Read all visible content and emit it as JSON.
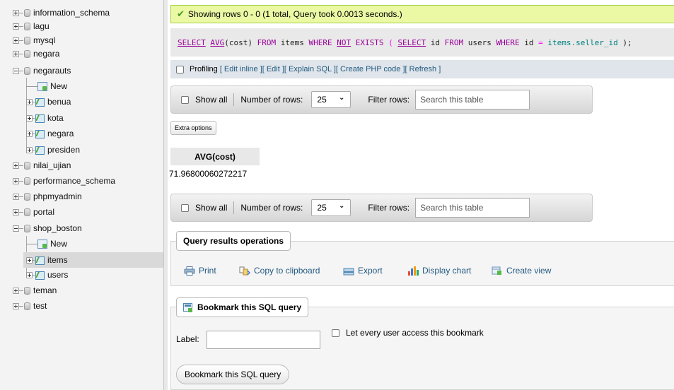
{
  "sidebar": {
    "items": [
      {
        "label": "information_schema",
        "kind": "db",
        "expanded": false
      },
      {
        "label": "lagu",
        "kind": "db",
        "expanded": false
      },
      {
        "label": "mysql",
        "kind": "db",
        "expanded": false
      },
      {
        "label": "negara",
        "kind": "db",
        "expanded": false
      },
      {
        "label": "negarauts",
        "kind": "db",
        "expanded": true
      },
      {
        "label": "New",
        "kind": "new"
      },
      {
        "label": "benua",
        "kind": "table"
      },
      {
        "label": "kota",
        "kind": "table"
      },
      {
        "label": "negara",
        "kind": "table"
      },
      {
        "label": "presiden",
        "kind": "table"
      },
      {
        "label": "nilai_ujian",
        "kind": "db",
        "expanded": false
      },
      {
        "label": "performance_schema",
        "kind": "db",
        "expanded": false
      },
      {
        "label": "phpmyadmin",
        "kind": "db",
        "expanded": false
      },
      {
        "label": "portal",
        "kind": "db",
        "expanded": false
      },
      {
        "label": "shop_boston",
        "kind": "db",
        "expanded": true
      },
      {
        "label": "New",
        "kind": "new"
      },
      {
        "label": "items",
        "kind": "table",
        "selected": true
      },
      {
        "label": "users",
        "kind": "table"
      },
      {
        "label": "teman",
        "kind": "db",
        "expanded": false
      },
      {
        "label": "test",
        "kind": "db",
        "expanded": false
      }
    ]
  },
  "status": {
    "message": "Showing rows 0 - 0 (1 total, Query took 0.0013 seconds.)",
    "color": "#ebf8a4"
  },
  "sql": {
    "select": "SELECT",
    "avg": "AVG",
    "arg": "(cost)",
    "from": "FROM",
    "table": "items",
    "where": "WHERE",
    "not": "NOT",
    "exists": "EXISTS",
    "open": "(",
    "select2": "SELECT",
    "id": "id",
    "from2": "FROM",
    "users": "users",
    "where2": "WHERE",
    "id2": "id",
    "eq": "=",
    "col": "items.seller_id",
    "close": ");"
  },
  "profiling": {
    "label": "Profiling",
    "links": [
      "[ Edit inline ]",
      "[ Edit ]",
      "[ Explain SQL ]",
      "[ Create PHP code ]",
      "[ Refresh ]"
    ]
  },
  "nav": {
    "show_all": "Show all",
    "rows_label": "Number of rows:",
    "rows_value": "25",
    "filter_label": "Filter rows:",
    "search_placeholder": "Search this table"
  },
  "extra_options": "Extra options",
  "result": {
    "column": "AVG(cost)",
    "value": "71.96800060272217"
  },
  "operations": {
    "title": "Query results operations",
    "items": [
      "Print",
      "Copy to clipboard",
      "Export",
      "Display chart",
      "Create view"
    ]
  },
  "bookmark": {
    "title": "Bookmark this SQL query",
    "label_text": "Label:",
    "share_text": "Let every user access this bookmark",
    "button": "Bookmark this SQL query"
  }
}
